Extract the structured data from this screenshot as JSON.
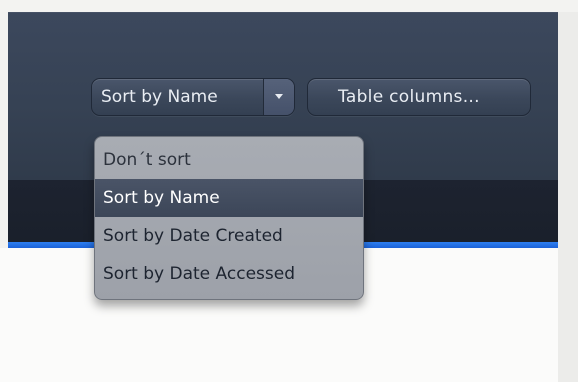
{
  "toolbar": {
    "sort_select": {
      "selected": "Sort by Name",
      "arrow_icon": "chevron-down-icon"
    },
    "table_columns_label": "Table columns..."
  },
  "sort_menu": {
    "items": [
      {
        "label": "Don´t sort"
      },
      {
        "label": "Sort by Name",
        "highlighted": true
      },
      {
        "label": "Sort by Date Created"
      },
      {
        "label": "Sort by Date Accessed"
      }
    ]
  },
  "colors": {
    "panel": "#364254",
    "accent": "#1c62d8",
    "menu_bg": "#a3a7ae",
    "highlight": "#434d60"
  }
}
